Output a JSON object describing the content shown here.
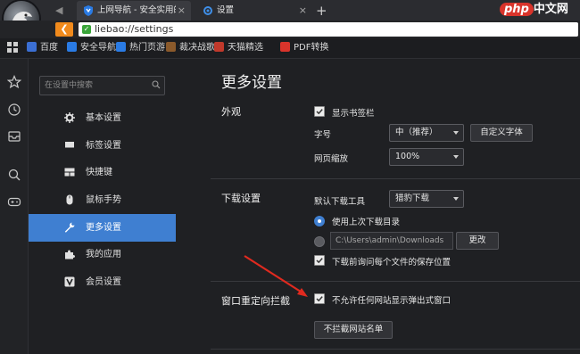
{
  "tabs": [
    {
      "label": "上网导航 - 安全实用的网",
      "close": "×"
    },
    {
      "label": "设置",
      "close": "×"
    }
  ],
  "new_tab": "+",
  "watermark": {
    "p": "php",
    "rest": "中文网"
  },
  "address": {
    "url": "liebao://settings"
  },
  "bookmarks": [
    {
      "label": "百度",
      "color": "#3b6fd4"
    },
    {
      "label": "安全导航",
      "color": "#2a7be4"
    },
    {
      "label": "热门页游",
      "color": "#2a7be4"
    },
    {
      "label": "裁决战歌",
      "color": "#8b5a2b"
    },
    {
      "label": "天猫精选",
      "color": "#c0392b"
    },
    {
      "label": "PDF转换",
      "color": "#d9342b"
    }
  ],
  "sidebar": {
    "search_placeholder": "在设置中搜索",
    "items": [
      {
        "label": "基本设置",
        "icon": "gear-icon"
      },
      {
        "label": "标签设置",
        "icon": "tab-icon"
      },
      {
        "label": "快捷键",
        "icon": "keyboard-icon"
      },
      {
        "label": "鼠标手势",
        "icon": "mouse-icon"
      },
      {
        "label": "更多设置",
        "icon": "wrench-icon"
      },
      {
        "label": "我的应用",
        "icon": "puzzle-icon"
      },
      {
        "label": "会员设置",
        "icon": "vip-icon"
      }
    ],
    "active_index": 4
  },
  "main": {
    "title": "更多设置",
    "appearance": {
      "heading": "外观",
      "show_bookmark_bar": "显示书签栏",
      "font_size_label": "字号",
      "font_size_value": "中（推荐）",
      "custom_font_button": "自定义字体",
      "zoom_label": "网页缩放",
      "zoom_value": "100%"
    },
    "download": {
      "heading": "下载设置",
      "tool_label": "默认下载工具",
      "tool_value": "猎豹下载",
      "use_last_dir": "使用上次下载目录",
      "dir_path": "C:\\Users\\admin\\Downloads",
      "change_button": "更改",
      "ask_before": "下载前询问每个文件的保存位置"
    },
    "popup": {
      "heading": "窗口重定向拦截",
      "block_label": "不允许任何网站显示弹出式窗口",
      "whitelist_button": "不拦截网站名单"
    }
  },
  "colors": {
    "accent": "#3f7fd1",
    "radio_selected": "#3f7fd1",
    "annotation_arrow": "#e02a1f",
    "back_button": "#f08a1c"
  }
}
